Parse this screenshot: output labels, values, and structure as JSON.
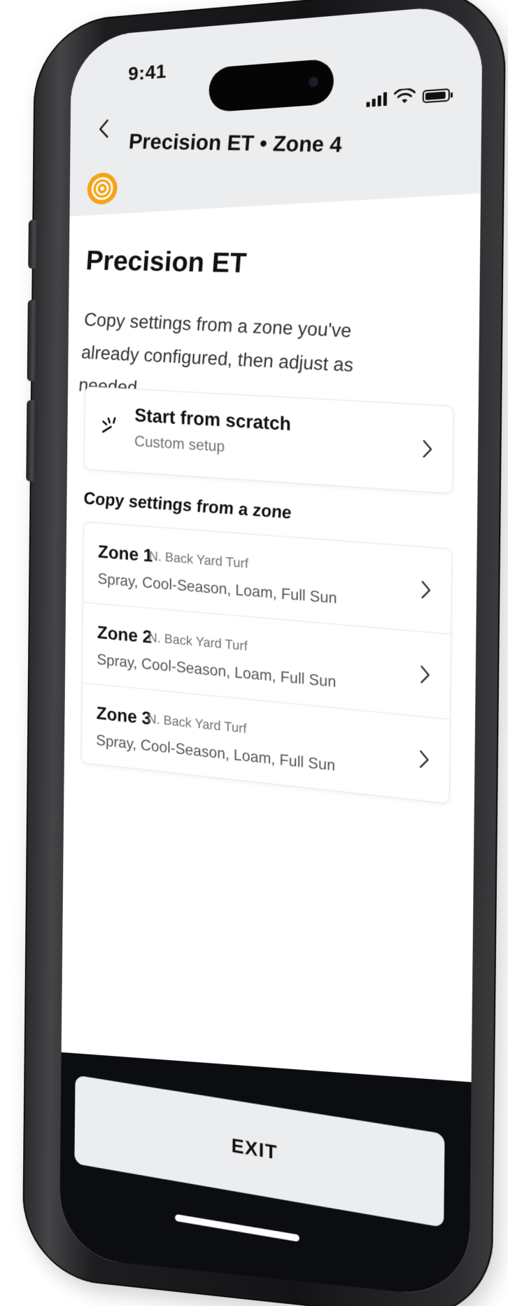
{
  "status_bar": {
    "time": "9:41"
  },
  "nav": {
    "title": "Precision ET • Zone 4"
  },
  "page": {
    "title": "Precision ET",
    "description": "Copy settings from a zone you've already configured, then adjust as needed."
  },
  "start_option": {
    "title": "Start from scratch",
    "subtitle": "Custom setup"
  },
  "zones_section": {
    "title": "Copy settings from a zone",
    "zones": [
      {
        "name": "Zone 1",
        "location": "N. Back Yard Turf",
        "attributes": "Spray, Cool-Season, Loam, Full Sun"
      },
      {
        "name": "Zone 2",
        "location": "N. Back Yard Turf",
        "attributes": "Spray, Cool-Season, Loam, Full Sun"
      },
      {
        "name": "Zone 3",
        "location": "N. Back Yard Turf",
        "attributes": "Spray, Cool-Season, Loam, Full Sun"
      }
    ]
  },
  "footer": {
    "exit_label": "EXIT"
  },
  "colors": {
    "accent": "#f5a316",
    "header_bg": "#ebedef",
    "footer_bg": "#0b0d10",
    "device_frame": "#1d1d1f"
  },
  "icons": {
    "back": "chevron-left-icon",
    "brand": "target-icon",
    "scratch": "sparkle-icon",
    "row": "chevron-right-icon"
  }
}
